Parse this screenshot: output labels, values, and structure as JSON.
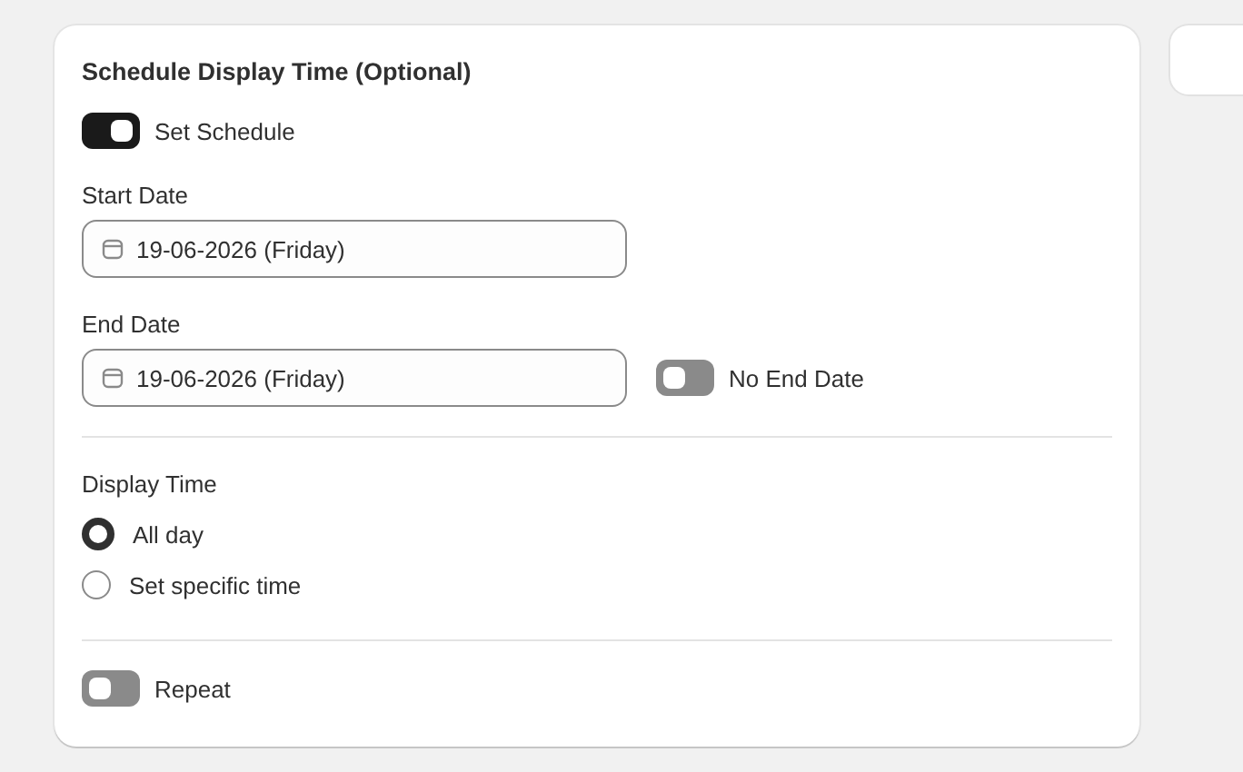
{
  "card": {
    "title": "Schedule Display Time (Optional)",
    "schedule_toggle": {
      "label": "Set Schedule",
      "on": true
    },
    "start_date": {
      "label": "Start Date",
      "value": "19-06-2026 (Friday)"
    },
    "end_date": {
      "label": "End Date",
      "value": "19-06-2026 (Friday)",
      "no_end_toggle": {
        "label": "No End Date",
        "on": false
      }
    },
    "display_time": {
      "label": "Display Time",
      "options": [
        {
          "label": "All day",
          "selected": true
        },
        {
          "label": "Set specific time",
          "selected": false
        }
      ]
    },
    "repeat_toggle": {
      "label": "Repeat",
      "on": false
    }
  }
}
